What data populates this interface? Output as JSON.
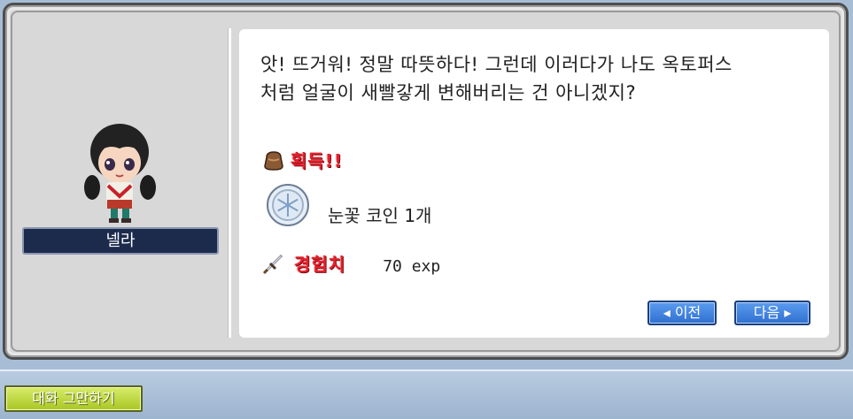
{
  "npc": {
    "name": "넬라"
  },
  "dialog": {
    "line1": "앗! 뜨거워! 정말 따뜻하다! 그런데 이러다가 나도 옥토퍼스",
    "line2": "처럼 얼굴이 새빨갛게 변해버리는 건 아니겠지?"
  },
  "rewards": {
    "obtain_label": "획득!!",
    "item_text": "눈꽃 코인 1개",
    "exp_label": "경험치",
    "exp_value": "70 exp"
  },
  "buttons": {
    "prev": "◂ 이전",
    "next": "다음 ▸",
    "end_chat": "대화 그만하기"
  },
  "icons": {
    "obtain": "pouch-icon",
    "item": "snowflake-coin-icon",
    "exp": "sword-icon"
  }
}
